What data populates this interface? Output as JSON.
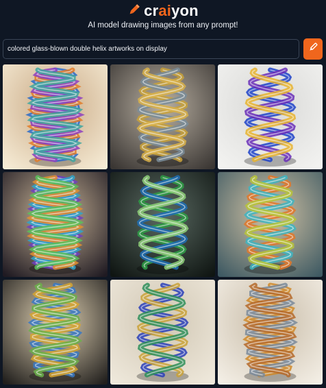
{
  "header": {
    "logo_prefix": "cr",
    "logo_accent": "ai",
    "logo_suffix": "yon",
    "logo_icon": "pencil-icon",
    "tagline": "AI model drawing images from any prompt!"
  },
  "prompt": {
    "value": "colored glass-blown double helix artworks on display"
  },
  "draw_button": {
    "icon": "brush-icon"
  },
  "colors": {
    "background": "#0f1724",
    "accent": "#f0661d"
  },
  "results": [
    {
      "bg": [
        "#f6ecd6",
        "#c9a985"
      ],
      "colors": [
        "#2a6bc9",
        "#e27d2a",
        "#8e3fbf",
        "#3fa6a0"
      ],
      "turns": 5.5
    },
    {
      "bg": [
        "#3a3633",
        "#b9b0a2"
      ],
      "colors": [
        "#c9a23a",
        "#7a8d9a",
        "#d9b24a"
      ],
      "turns": 3.2
    },
    {
      "bg": [
        "#f3f3f1",
        "#d8d8d6"
      ],
      "colors": [
        "#1e43c9",
        "#6a2fb8",
        "#e8b430"
      ],
      "turns": 3.0
    },
    {
      "bg": [
        "#1f1a22",
        "#cdb89a"
      ],
      "colors": [
        "#6f3fbf",
        "#2fa5c9",
        "#e0912f",
        "#5abf5a"
      ],
      "turns": 5.0
    },
    {
      "bg": [
        "#0f1512",
        "#5b6b63"
      ],
      "colors": [
        "#2f9f46",
        "#1f6fb5",
        "#8fd07a"
      ],
      "turns": 2.8
    },
    {
      "bg": [
        "#3f5a63",
        "#d4c4a5"
      ],
      "colors": [
        "#e2782a",
        "#3fb5c2",
        "#b7c43a"
      ],
      "turns": 3.4
    },
    {
      "bg": [
        "#211f1d",
        "#e4d5b6"
      ],
      "colors": [
        "#3a79c4",
        "#d6a530",
        "#6bb04a"
      ],
      "turns": 4.2
    },
    {
      "bg": [
        "#efe9dc",
        "#d0c6b3"
      ],
      "colors": [
        "#2a3fb8",
        "#c9a23a",
        "#2f8f5a"
      ],
      "turns": 3.0
    },
    {
      "bg": [
        "#f4efe6",
        "#c8bca8"
      ],
      "colors": [
        "#d08a2a",
        "#7a8a9a",
        "#b56a2a"
      ],
      "turns": 4.6
    }
  ]
}
